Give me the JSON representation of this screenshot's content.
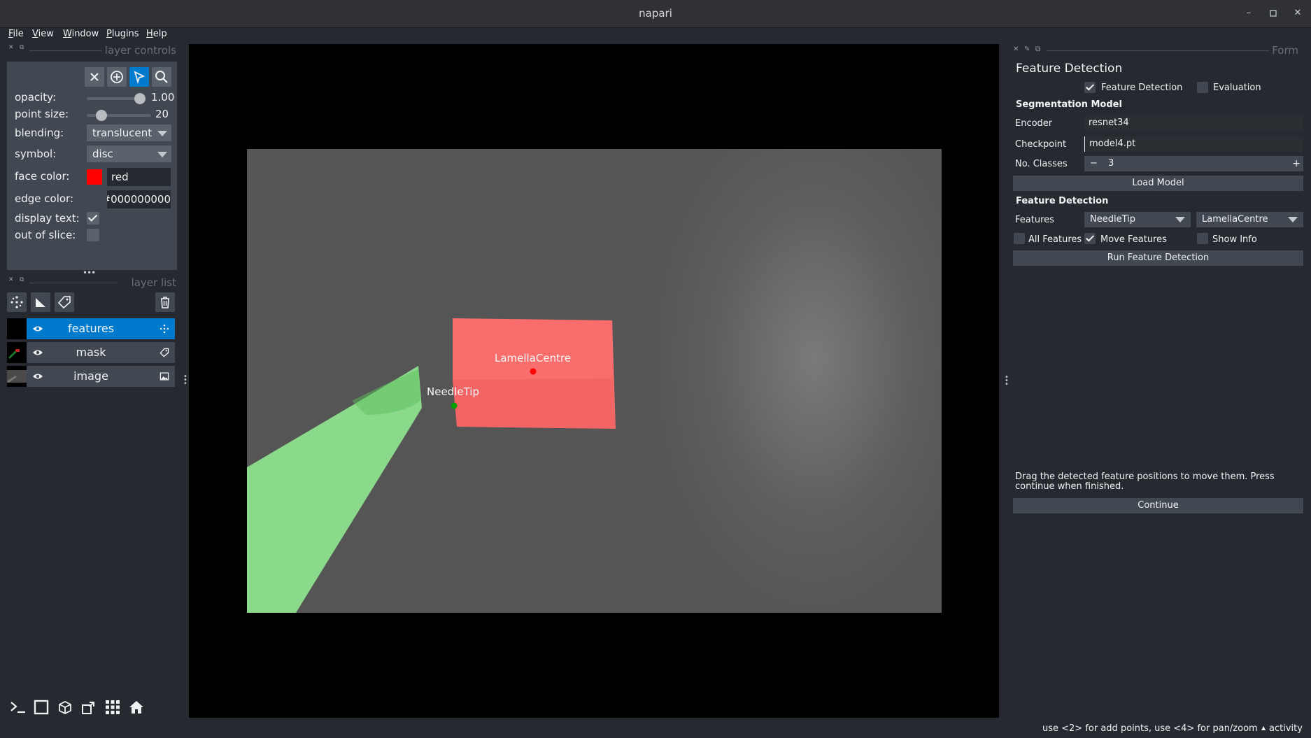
{
  "window": {
    "title": "napari",
    "minimize": "–",
    "restore": "▫",
    "close": "✕"
  },
  "menubar": [
    "File",
    "View",
    "Window",
    "Plugins",
    "Help"
  ],
  "layer_controls": {
    "dock_title": "layer controls",
    "opacity_label": "opacity:",
    "opacity_value": "1.00",
    "opacity_level": 1.0,
    "point_size_label": "point size:",
    "point_size_value": "20",
    "point_size_level": 0.15,
    "blending_label": "blending:",
    "blending_value": "translucent",
    "symbol_label": "symbol:",
    "symbol_value": "disc",
    "face_color_label": "face color:",
    "face_color_value": "red",
    "face_color_swatch": "#ff0000",
    "edge_color_label": "edge color:",
    "edge_color_value": "#000000000",
    "display_text_label": "display text:",
    "display_text_checked": true,
    "out_of_slice_label": "out of slice:",
    "out_of_slice_checked": false
  },
  "layer_list": {
    "dock_title": "layer list",
    "handle": "•••",
    "layers": [
      {
        "name": "features",
        "selected": true,
        "type_icon": "points-icon"
      },
      {
        "name": "mask",
        "selected": false,
        "type_icon": "labels-icon"
      },
      {
        "name": "image",
        "selected": false,
        "type_icon": "image-icon"
      }
    ]
  },
  "canvas": {
    "labels": {
      "lamella": "LamellaCentre",
      "needle": "NeedleTip"
    },
    "colors": {
      "lamella": "#ff6e6e",
      "needle": "#8ee08e",
      "lamella_point": "#ff0000",
      "needle_point": "#00a000"
    }
  },
  "form": {
    "dock_title": "Form",
    "title": "Feature Detection",
    "mode_feature_detection": "Feature Detection",
    "mode_feature_detection_checked": true,
    "mode_evaluation": "Evaluation",
    "mode_evaluation_checked": false,
    "seg_model_header": "Segmentation Model",
    "encoder_label": "Encoder",
    "encoder_value": "resnet34",
    "checkpoint_label": "Checkpoint",
    "checkpoint_value": "model4.pt",
    "num_classes_label": "No. Classes",
    "num_classes_value": "3",
    "stepper_minus": "−",
    "stepper_plus": "+",
    "load_model_button": "Load Model",
    "feature_det_header": "Feature Detection",
    "features_label": "Features",
    "feature_1": "NeedleTip",
    "feature_2": "LamellaCentre",
    "all_features": "All Features",
    "all_features_checked": false,
    "move_features": "Move Features",
    "move_features_checked": true,
    "show_info": "Show Info",
    "show_info_checked": false,
    "run_button": "Run Feature Detection",
    "instructions": "Drag the detected feature positions to move them. Press continue when finished.",
    "continue_button": "Continue"
  },
  "status": {
    "hint": "use <2> for add points, use <4> for pan/zoom",
    "activity": "activity",
    "activity_arrow": "▲"
  }
}
